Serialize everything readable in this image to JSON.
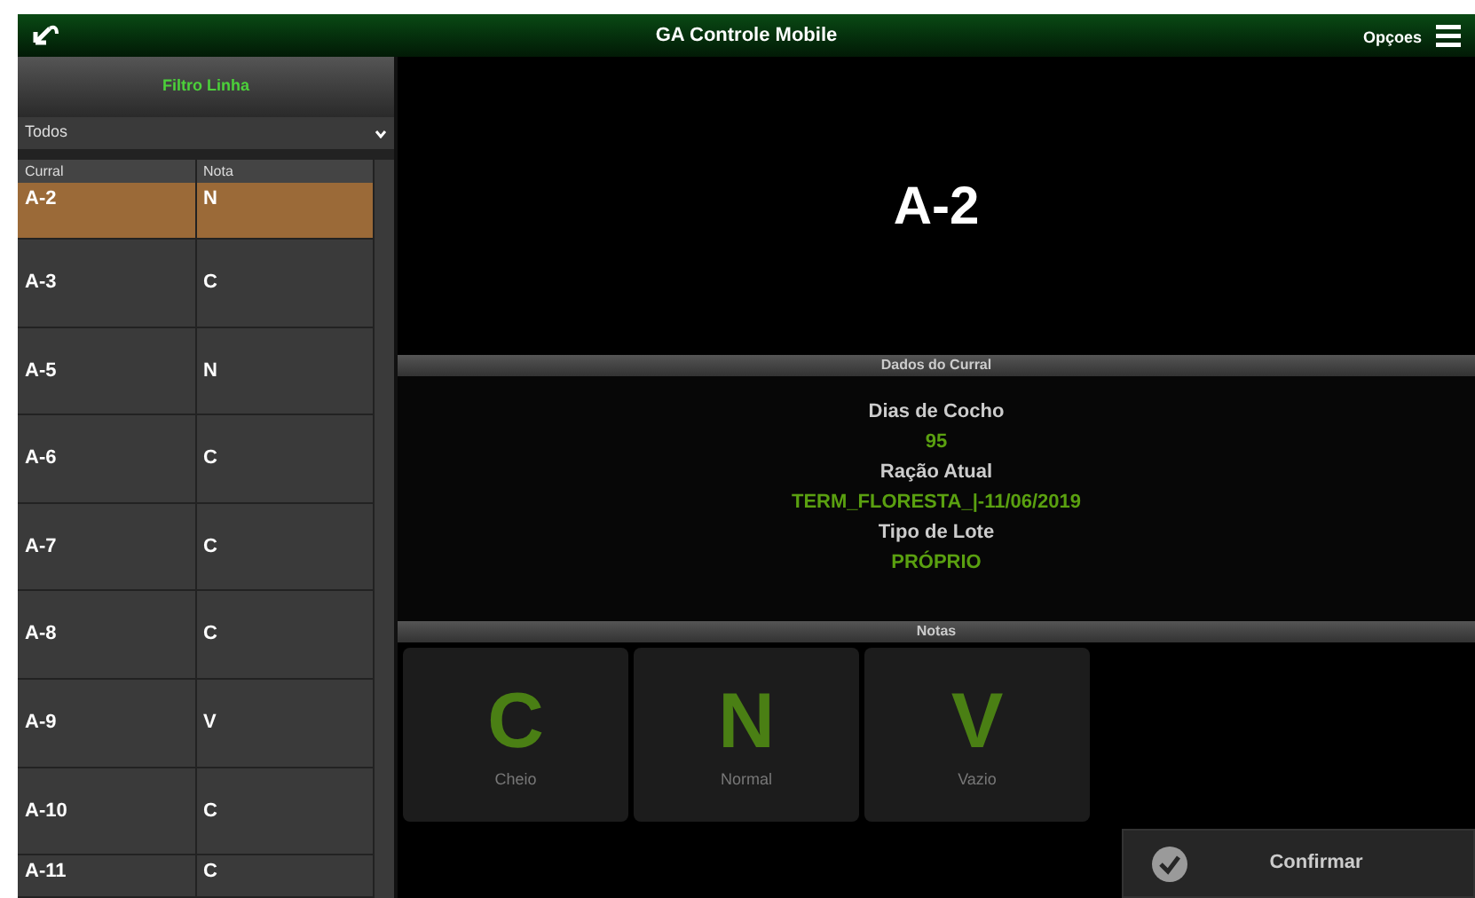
{
  "window": {
    "title": "GA Controle Mobile",
    "options_label": "Opçoes"
  },
  "filter": {
    "title": "Filtro Linha",
    "select_value": "Todos"
  },
  "table": {
    "columns": [
      "Curral",
      "Nota"
    ],
    "rows": [
      {
        "curral": "A-2",
        "nota": "N",
        "selected": true
      },
      {
        "curral": "A-3",
        "nota": "C",
        "selected": false
      },
      {
        "curral": "A-5",
        "nota": "N",
        "selected": false
      },
      {
        "curral": "A-6",
        "nota": "C",
        "selected": false
      },
      {
        "curral": "A-7",
        "nota": "C",
        "selected": false
      },
      {
        "curral": "A-8",
        "nota": "C",
        "selected": false
      },
      {
        "curral": "A-9",
        "nota": "V",
        "selected": false
      },
      {
        "curral": "A-10",
        "nota": "C",
        "selected": false
      },
      {
        "curral": "A-11",
        "nota": "C",
        "selected": false
      }
    ]
  },
  "detail": {
    "heading": "A-2",
    "section_title": "Dados do Curral",
    "fields": [
      {
        "label": "Dias de Cocho",
        "value": "95"
      },
      {
        "label": "Ração Atual",
        "value": "TERM_FLORESTA_|-11/06/2019"
      },
      {
        "label": "Tipo de Lote",
        "value": "PRÓPRIO"
      }
    ]
  },
  "notes": {
    "title": "Notas",
    "options": [
      {
        "letter": "C",
        "label": "Cheio"
      },
      {
        "letter": "N",
        "label": "Normal"
      },
      {
        "letter": "V",
        "label": "Vazio"
      }
    ]
  },
  "confirm_button": "Confirmar"
}
